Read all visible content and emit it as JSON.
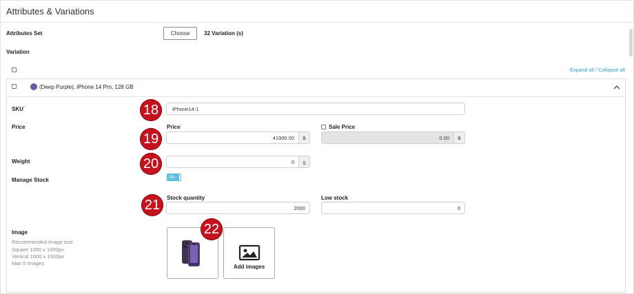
{
  "header": {
    "title": "Attributes & Variations"
  },
  "attributes_set": {
    "label": "Attributes Set",
    "choose_label": "Choose",
    "variation_count": "32 Variation (s)"
  },
  "variation_section": {
    "label": "Variation",
    "expand_collapse": "Expand all / Collapse all"
  },
  "variation": {
    "title": "(Deep Purple), iPhone 14 Pro, 128 GB",
    "swatch_color": "#6a5aa6",
    "sku": {
      "label": "SKU",
      "required_mark": "*",
      "value": "iPhone14-1"
    },
    "price": {
      "section_label": "Price",
      "label": "Price",
      "required_mark": "*",
      "value": "41900.00",
      "currency": "฿",
      "sale_label": "Sale Price",
      "sale_value": "0.00",
      "sale_currency": "฿"
    },
    "weight": {
      "label": "Weight",
      "value": "0",
      "unit": "g"
    },
    "manage_stock": {
      "label": "Manage Stock",
      "toggle_label": "On",
      "enabled": true
    },
    "stock": {
      "quantity_label": "Stock quantity",
      "required_mark": "*",
      "quantity_value": "2000",
      "low_label": "Low stock",
      "low_value": "0"
    },
    "image": {
      "label": "Image",
      "hint_title": "Recommended image size",
      "hint_square": "Square 1000 x 1000px",
      "hint_vertical": "Vertical 1000 x 1500px",
      "hint_max": "Max 5 Images",
      "add_label": "Add images"
    }
  },
  "annotations": [
    "18",
    "19",
    "20",
    "21",
    "22"
  ],
  "colors": {
    "accent": "#5bc0de",
    "link": "#2d9bd6",
    "marker": "#c4121e"
  }
}
